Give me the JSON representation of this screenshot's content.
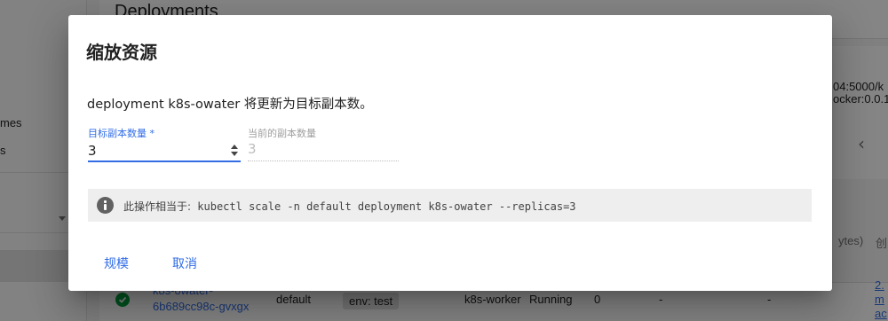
{
  "background": {
    "page_title": "Deployments",
    "sidebar": {
      "item_1_fragment": "mes",
      "item_2_fragment": "s"
    },
    "image_text_line_1": "04:5000/k",
    "image_text_line_2": "ocker:0.0.1-",
    "column_header_fragment": "ytes)",
    "column_header_fragment_2": "创",
    "row": {
      "name_line_1": "k8s-owater-",
      "name_line_2": "6b689cc98c-gvxgx",
      "namespace": "default",
      "label_chip": "env: test",
      "node": "k8s-worker",
      "status": "Running",
      "restarts": "0",
      "cpu": "-",
      "memory": "-",
      "right_link_1": "2.",
      "right_link_2": "m",
      "right_link_3": "ac"
    }
  },
  "dialog": {
    "title": "缩放资源",
    "message": "deployment k8s-owater 将更新为目标副本数。",
    "target_replicas": {
      "label": "目标副本数量 *",
      "value": "3"
    },
    "current_replicas": {
      "label": "当前的副本数量",
      "value": "3"
    },
    "info": {
      "prefix": "此操作相当于:",
      "command": "kubectl scale -n default deployment k8s-owater --replicas=3"
    },
    "buttons": {
      "scale": "规模",
      "cancel": "取消"
    }
  },
  "colors": {
    "accent": "#326de6",
    "success": "#00a03e",
    "scrim": "rgba(0,0,0,0.48)"
  }
}
